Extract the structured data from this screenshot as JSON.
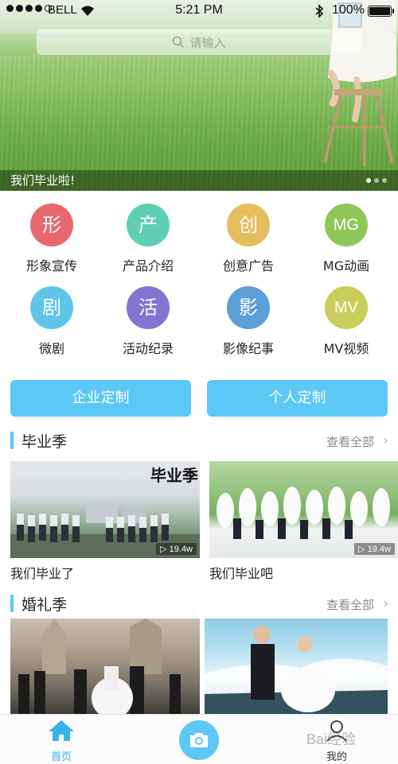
{
  "status_bar": {
    "carrier": "BELL",
    "time": "5:21 PM",
    "battery": "100%"
  },
  "search": {
    "placeholder": "请输入"
  },
  "banner": {
    "caption": "我们毕业啦!",
    "pages": 3,
    "active_page": 1
  },
  "categories": [
    {
      "label": "形象宣传",
      "glyph": "形",
      "color": "#e8686e"
    },
    {
      "label": "产品介绍",
      "glyph": "产",
      "color": "#5fcfb3"
    },
    {
      "label": "创意广告",
      "glyph": "创",
      "color": "#e5bd5e"
    },
    {
      "label": "MG动画",
      "glyph": "MG",
      "color": "#8fc659"
    },
    {
      "label": "微剧",
      "glyph": "剧",
      "color": "#5ec6e8"
    },
    {
      "label": "活动纪录",
      "glyph": "活",
      "color": "#8474d0"
    },
    {
      "label": "影像纪事",
      "glyph": "影",
      "color": "#5c9ed6"
    },
    {
      "label": "MV视频",
      "glyph": "MV",
      "color": "#c9cd5b"
    }
  ],
  "custom_buttons": {
    "enterprise": "企业定制",
    "personal": "个人定制"
  },
  "sections": [
    {
      "title": "毕业季",
      "more": "查看全部",
      "cards": [
        {
          "caption": "我们毕业了",
          "views": "19.4w",
          "photo_text": "毕业季"
        },
        {
          "caption": "我们毕业吧",
          "views": "19.4w"
        }
      ]
    },
    {
      "title": "婚礼季",
      "more": "查看全部",
      "cards": [
        {
          "caption": ""
        },
        {
          "caption": ""
        }
      ]
    }
  ],
  "tabbar": {
    "home": "首页",
    "mine": "我的",
    "watermark": "Bai经验"
  },
  "colors": {
    "accent": "#5bc8f5"
  }
}
